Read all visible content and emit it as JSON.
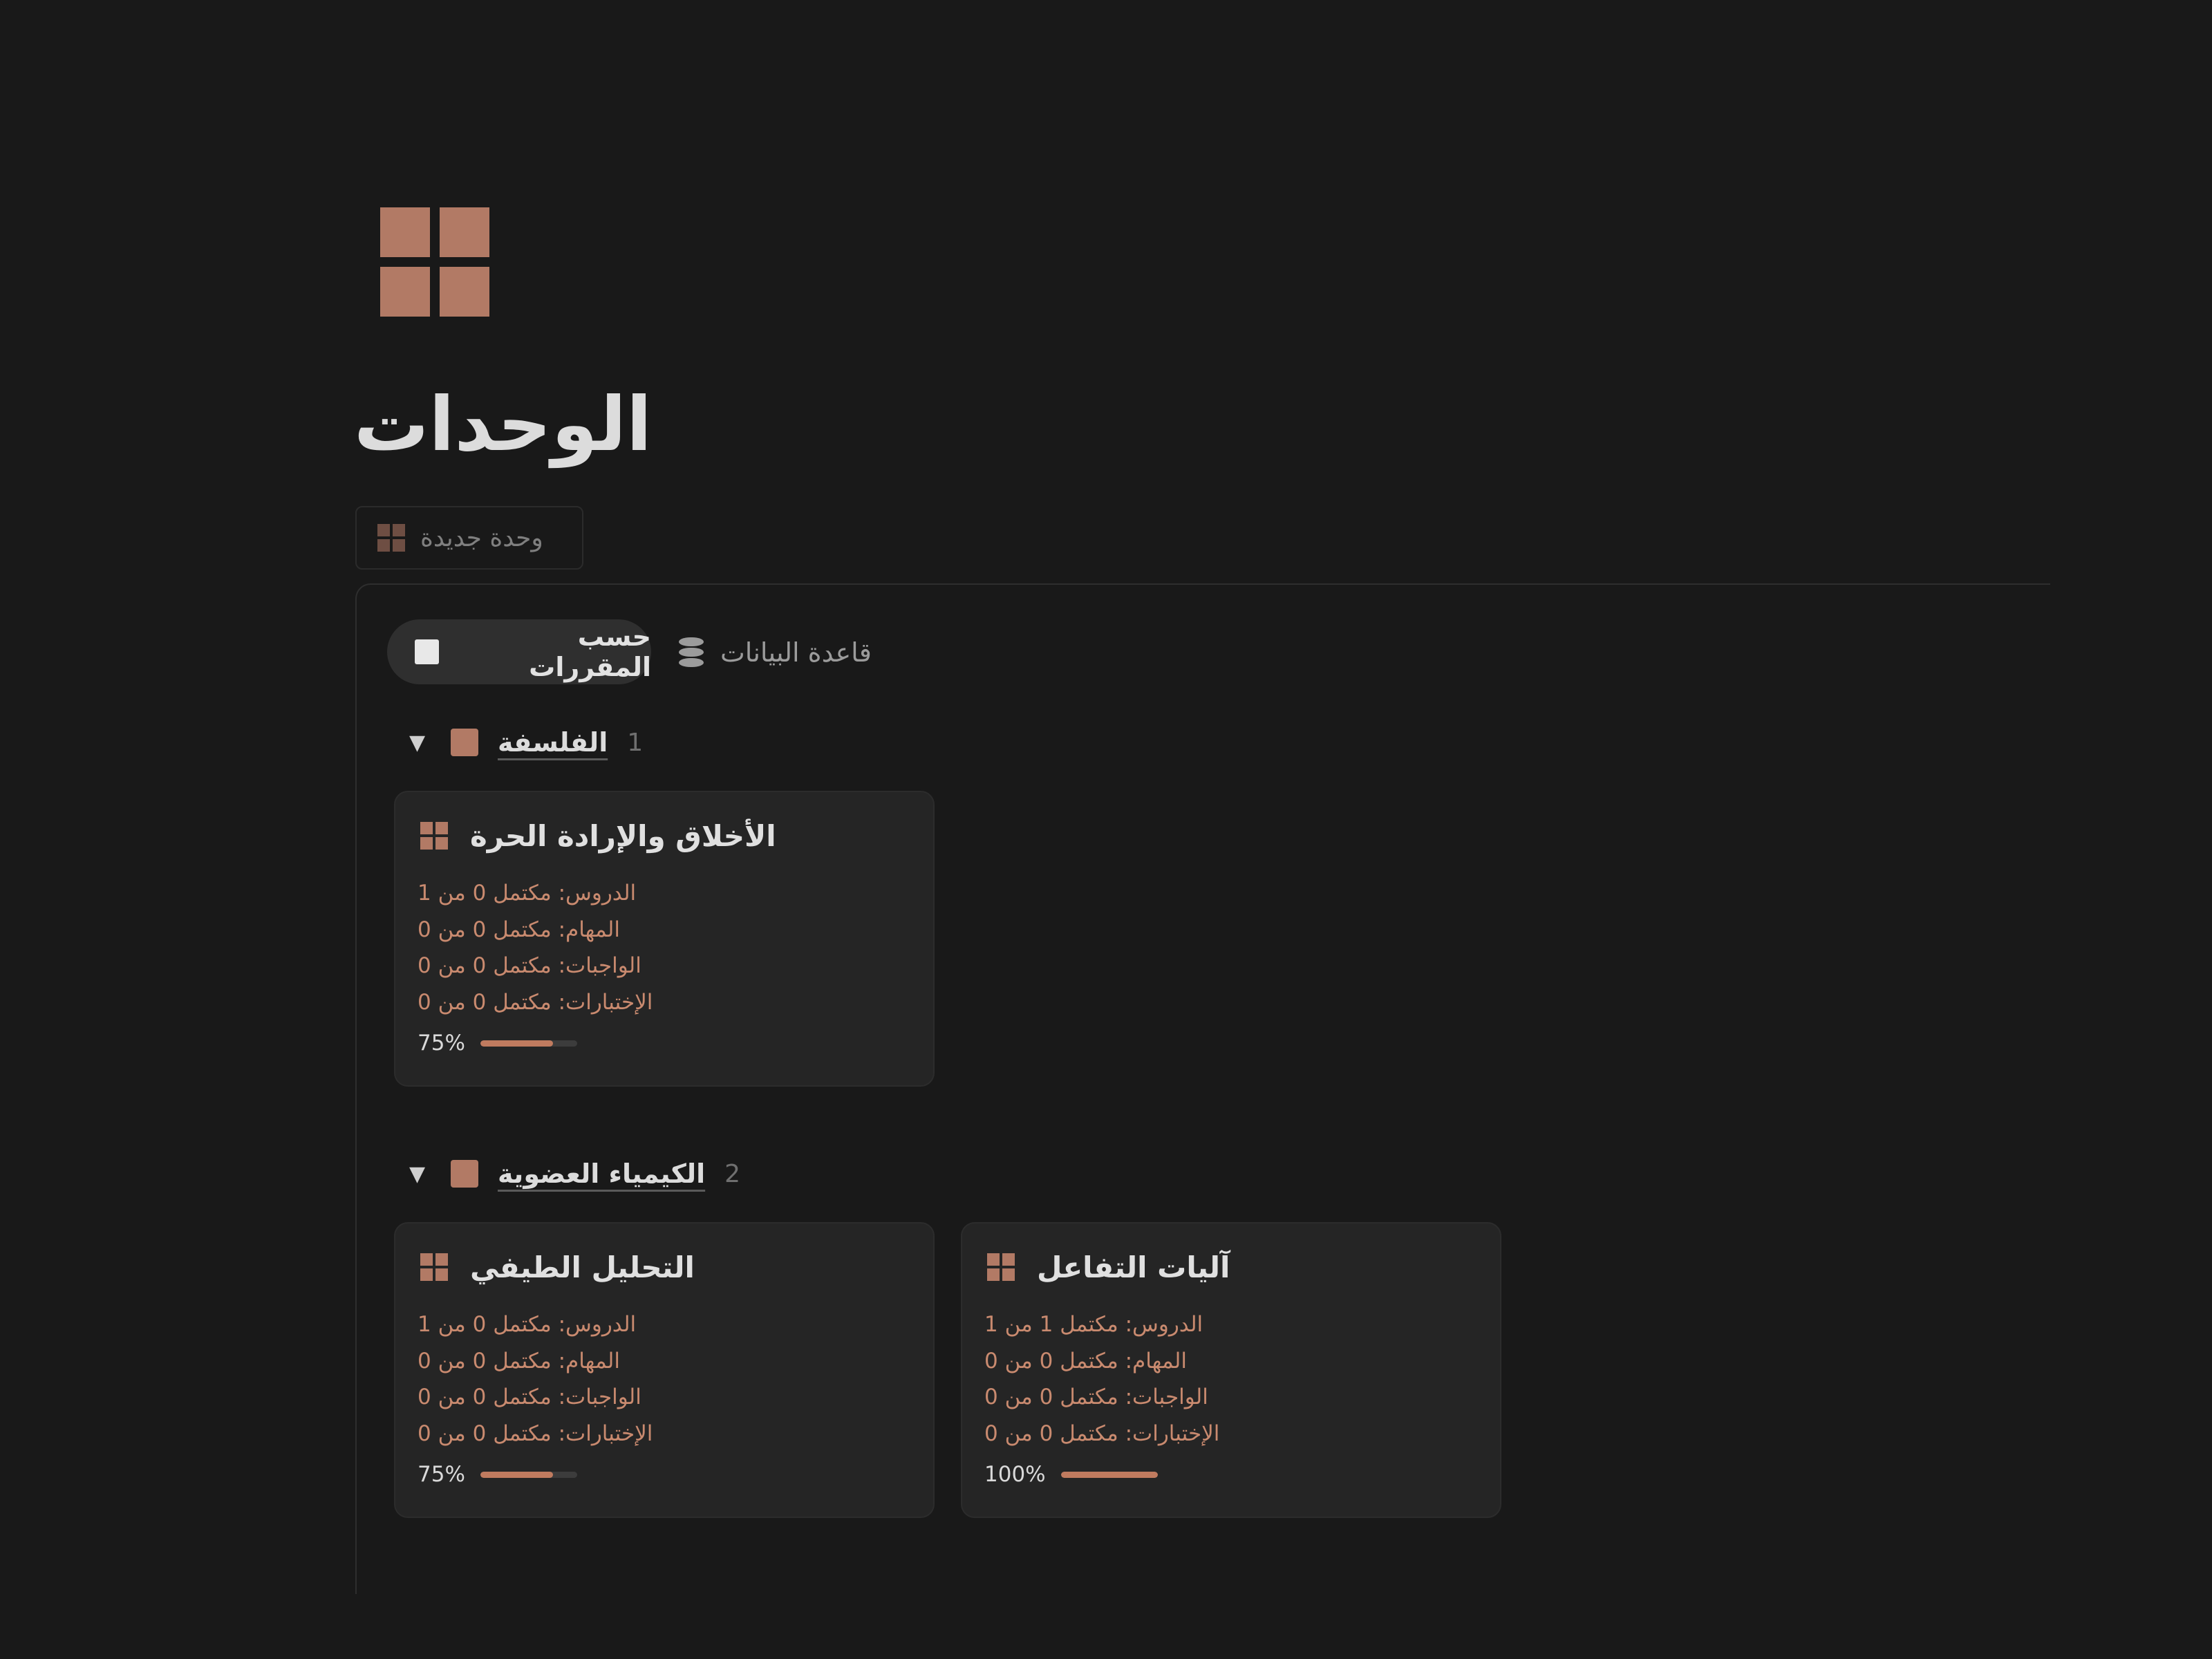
{
  "page": {
    "title": "الوحدات",
    "icon": "four-squares-grid-icon",
    "accent_color": "#b27a65"
  },
  "new_button": {
    "label": "وحدة جديدة",
    "icon": "four-squares-grid-icon"
  },
  "views": {
    "active": {
      "label": "حسب المقررات",
      "icon": "square-icon"
    },
    "database": {
      "label": "قاعدة البيانات",
      "icon": "database-icon"
    }
  },
  "groups": [
    {
      "name": "الفلسفة",
      "count": "1",
      "cards": [
        {
          "title": "الأخلاق والإرادة الحرة",
          "lines": [
            "الدروس: مكتمل 0 من 1",
            "المهام: مكتمل 0 من 0",
            "الواجبات: مكتمل 0 من 0",
            "الإختبارات: مكتمل 0 من 0"
          ],
          "progress_label": "75%",
          "progress": 0.75
        }
      ]
    },
    {
      "name": "الكيمياء العضوية",
      "count": "2",
      "cards": [
        {
          "title": "التحليل الطيفي",
          "lines": [
            "الدروس: مكتمل 0 من 1",
            "المهام: مكتمل 0 من 0",
            "الواجبات: مكتمل 0 من 0",
            "الإختبارات: مكتمل 0 من 0"
          ],
          "progress_label": "75%",
          "progress": 0.75
        },
        {
          "title": "آليات التفاعل",
          "lines": [
            "الدروس: مكتمل 1 من 1",
            "المهام: مكتمل 0 من 0",
            "الواجبات: مكتمل 0 من 0",
            "الإختبارات: مكتمل 0 من 0"
          ],
          "progress_label": "100%",
          "progress": 1.0
        }
      ]
    }
  ]
}
